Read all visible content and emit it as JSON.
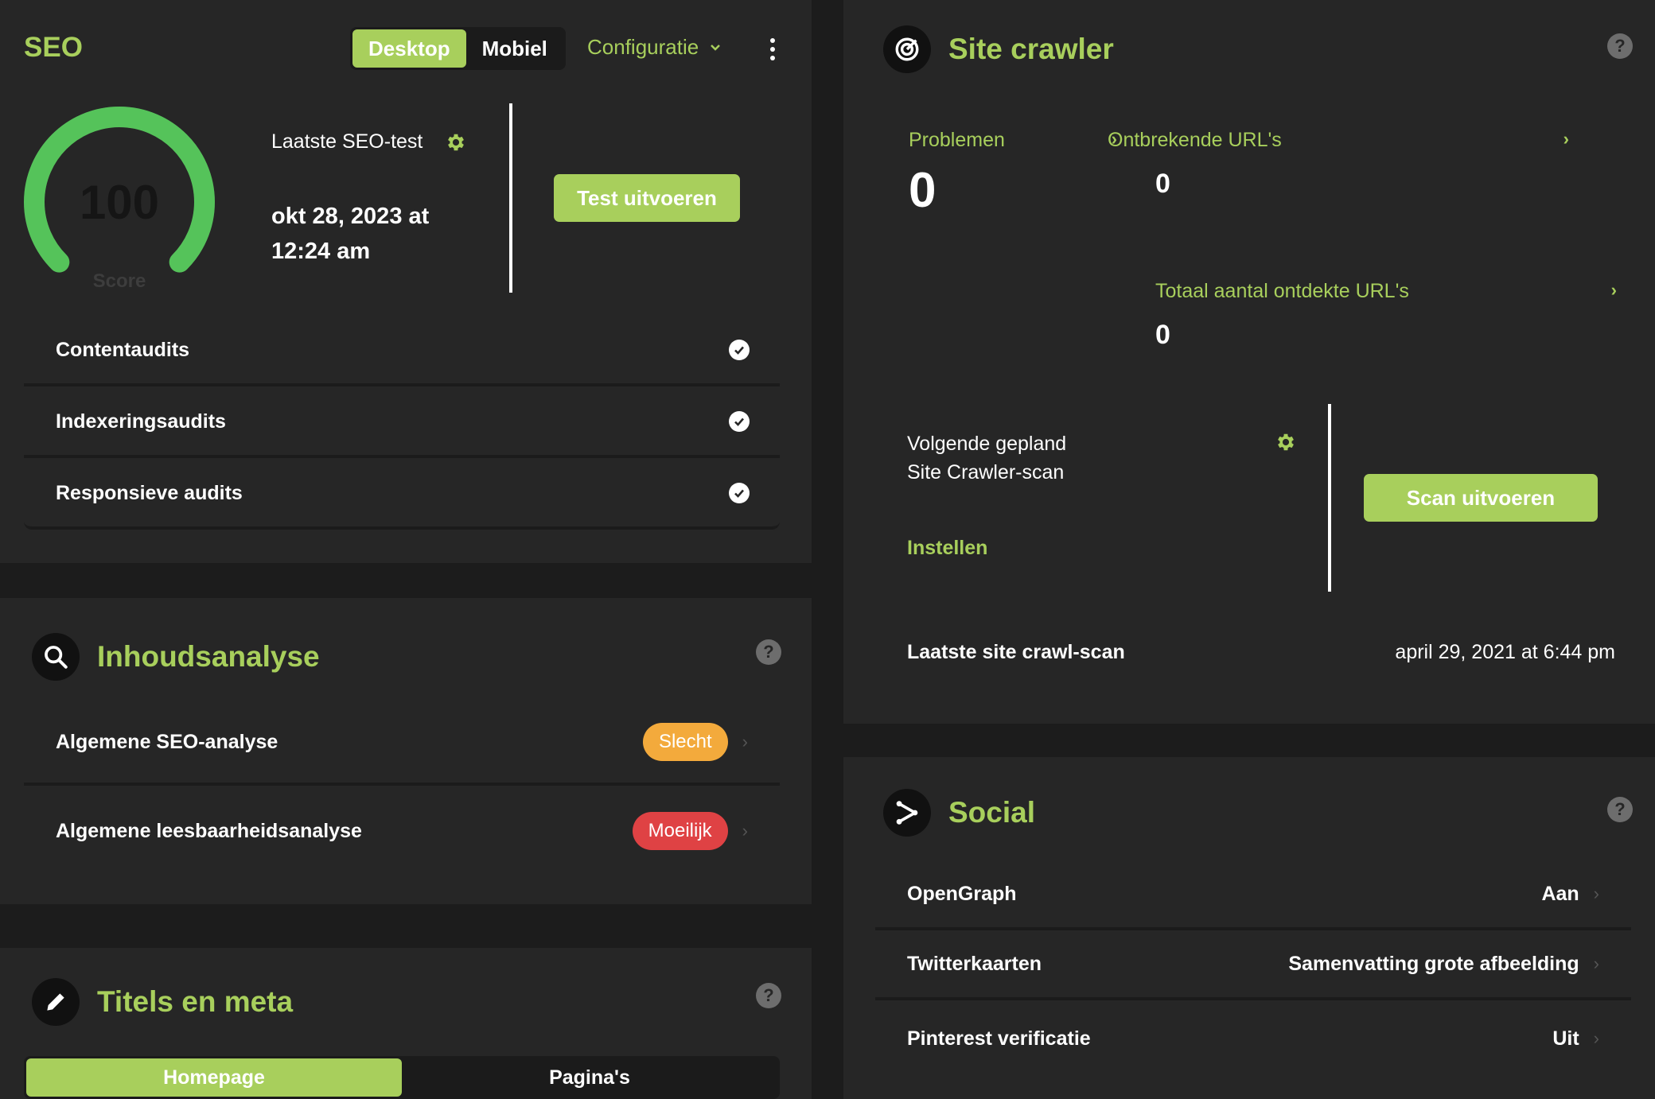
{
  "seo": {
    "title": "SEO",
    "device_tabs": [
      "Desktop",
      "Mobiel"
    ],
    "config_label": "Configuratie",
    "score_value": "100",
    "score_label": "Score",
    "score_fraction": 1.0,
    "last_test_label": "Laatste SEO-test",
    "last_test_date_line1": "okt 28, 2023 at",
    "last_test_date_line2": "12:24 am",
    "run_test_button": "Test uitvoeren",
    "audits": [
      {
        "label": "Contentaudits"
      },
      {
        "label": "Indexeringsaudits"
      },
      {
        "label": "Responsieve audits"
      }
    ]
  },
  "inhoud": {
    "title": "Inhoudsanalyse",
    "rows": [
      {
        "label": "Algemene SEO-analyse",
        "badge": "Slecht",
        "badge_color": "#f3aa3c"
      },
      {
        "label": "Algemene leesbaarheidsanalyse",
        "badge": "Moeilijk",
        "badge_color": "#df4244"
      }
    ]
  },
  "titels": {
    "title": "Titels en meta",
    "tabs": [
      "Homepage",
      "Pagina's"
    ]
  },
  "crawler": {
    "title": "Site crawler",
    "problemen_label": "Problemen",
    "problemen_value": "0",
    "ontbrekende_label": "Ontbrekende URL's",
    "ontbrekende_value": "0",
    "totaal_label": "Totaal aantal ontdekte URL's",
    "totaal_value": "0",
    "next_scan_line1": "Volgende gepland",
    "next_scan_line2": "Site Crawler-scan",
    "instellen_label": "Instellen",
    "scan_button": "Scan uitvoeren",
    "last_scan_label": "Laatste site crawl-scan",
    "last_scan_value": "april 29, 2021 at 6:44 pm"
  },
  "social": {
    "title": "Social",
    "rows": [
      {
        "label": "OpenGraph",
        "value": "Aan"
      },
      {
        "label": "Twitterkaarten",
        "value": "Samenvatting grote afbeelding"
      },
      {
        "label": "Pinterest verificatie",
        "value": "Uit"
      }
    ]
  },
  "help_glyph": "?",
  "colors": {
    "accent": "#a8cf5c",
    "gauge": "#55c35a",
    "panel": "#262626",
    "background": "#1c1c1c"
  }
}
